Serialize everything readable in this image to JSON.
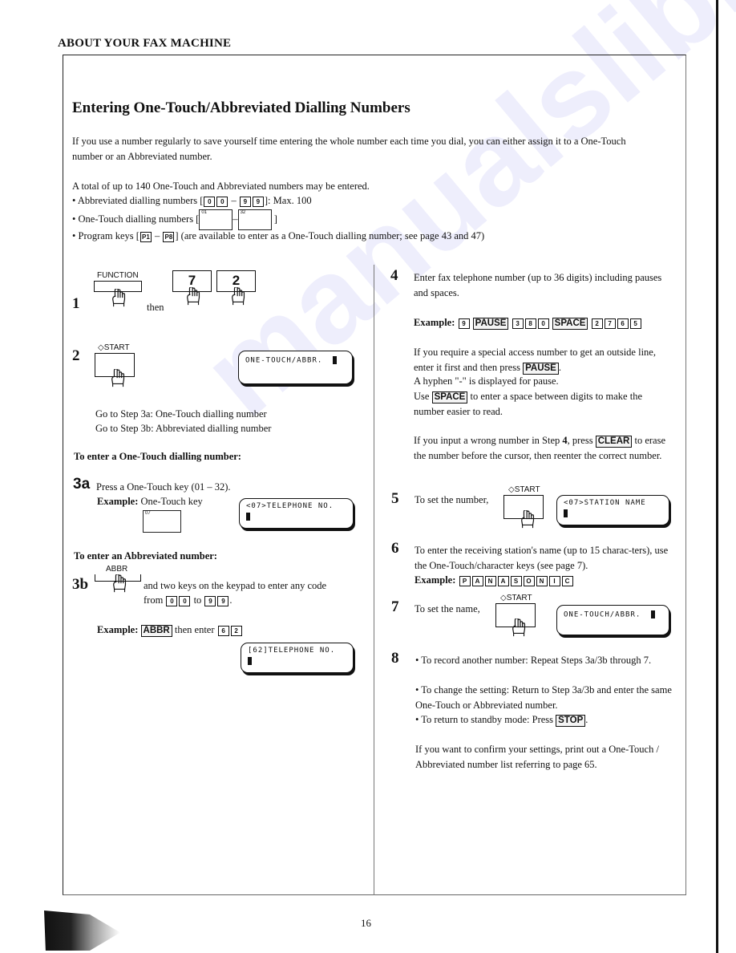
{
  "header": {
    "section": "ABOUT YOUR FAX MACHINE"
  },
  "title": "Entering One-Touch/Abbreviated Dialling Numbers",
  "intro": "If you use a number regularly to save yourself time entering the whole number each time you dial, you can either assign it to a One-Touch number or an Abbreviated number.",
  "total": "A total of up to 140 One-Touch and Abbreviated numbers may be entered.",
  "bullets": {
    "abbr_prefix": "Abbreviated dialling numbers [",
    "abbr_keys_from": [
      "0",
      "0"
    ],
    "abbr_keys_to": [
      "9",
      "9"
    ],
    "abbr_suffix": "]: Max. 100",
    "onetouch_prefix": "One-Touch dialling numbers [",
    "onetouch_from": "01",
    "onetouch_to": "32",
    "onetouch_suffix": "]",
    "program_prefix": "Program keys [",
    "program_from": "P1",
    "program_to": "P8",
    "program_suffix": "] (are available to enter as a One-Touch dialling number; see page 43 and 47)",
    "dash": "–",
    "bullet_char": "•"
  },
  "steps": {
    "s1": {
      "num": "1",
      "key_label": "FUNCTION",
      "then": "then",
      "keys": [
        "7",
        "2"
      ]
    },
    "s2": {
      "num": "2",
      "key_label": "START",
      "lcd_line1": "ONE-TOUCH/ABBR.",
      "goto_a": "Go to Step 3a: One-Touch dialling number",
      "goto_b": "Go to Step 3b: Abbreviated dialling number"
    },
    "sub_a": "To enter a One-Touch dialling number:",
    "s3a": {
      "num": "3a",
      "text": "Press a One-Touch key (01 – 32).",
      "example_label": "Example:",
      "example_text": "One-Touch key",
      "key": "07",
      "lcd_line1": "<07>TELEPHONE NO."
    },
    "sub_b": "To enter an Abbreviated number:",
    "s3b": {
      "num": "3b",
      "key_label": "ABBR",
      "text1": "and two keys on the keypad to enter any code",
      "text2_from": "from",
      "text2_to": "to",
      "keys_from": [
        "0",
        "0"
      ],
      "keys_to": [
        "9",
        "9"
      ],
      "example_label": "Example:",
      "example_key": "ABBR",
      "example_then": "then enter",
      "example_keys": [
        "6",
        "2"
      ],
      "lcd_line1": "[62]TELEPHONE NO."
    },
    "s4": {
      "num": "4",
      "text": "Enter fax telephone number (up to 36 digits) including pauses and spaces.",
      "example_label": "Example:",
      "example_keys": [
        "9",
        "PAUSE",
        "3",
        "8",
        "0",
        "SPACE",
        "2",
        "7",
        "6",
        "5"
      ],
      "p1a": "If you require a special access number to get an outside line, enter it first and then press",
      "p1_key": "PAUSE",
      "p1b": ".",
      "p2": "A hyphen \"-\" is displayed for pause.",
      "p3a": "Use",
      "p3_key": "SPACE",
      "p3b": "to enter a space between digits to make the number easier to read.",
      "p4a": "If you input a wrong number in Step",
      "p4_bold": "4",
      "p4b": ", press",
      "p4_key": "CLEAR",
      "p4c": "to erase the number before the cursor, then reenter the correct number."
    },
    "s5": {
      "num": "5",
      "text": "To set the number,",
      "key_label": "START",
      "lcd_line1": "<07>STATION NAME"
    },
    "s6": {
      "num": "6",
      "text": "To enter the receiving station's name (up to 15 charac-ters), use the One-Touch/character keys (see page 7).",
      "example_label": "Example:",
      "example_keys": [
        "P",
        "A",
        "N",
        "A",
        "S",
        "O",
        "N",
        "I",
        "C"
      ]
    },
    "s7": {
      "num": "7",
      "text": "To set the name,",
      "key_label": "START",
      "lcd_line1": "ONE-TOUCH/ABBR."
    },
    "s8": {
      "num": "8",
      "b1": "To record another number:  Repeat Steps 3a/3b through 7.",
      "b2": "To change the setting:  Return to Step 3a/3b and enter the same One-Touch or Abbreviated number.",
      "b3a": "To return to standby mode:  Press",
      "b3_key": "STOP",
      "b3b": ".",
      "note": "If you want to confirm your settings, print out a One-Touch / Abbreviated number list referring to page 65."
    }
  },
  "footer": {
    "page_number": "16"
  },
  "watermark": "manualslib.com"
}
